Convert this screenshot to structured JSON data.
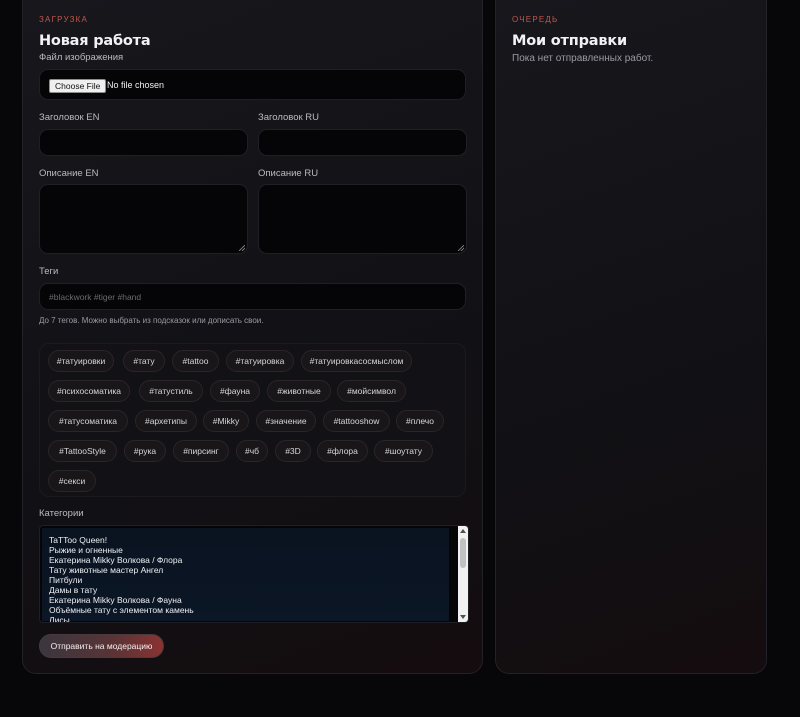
{
  "upload": {
    "eyebrow": "ЗАГРУЗКА",
    "title": "Новая работа",
    "image_label": "Файл изображения",
    "file_button": "Choose File",
    "file_status": "No file chosen",
    "title_en_label": "Заголовок EN",
    "title_ru_label": "Заголовок RU",
    "desc_en_label": "Описание EN",
    "desc_ru_label": "Описание RU",
    "tags_label": "Теги",
    "tags_placeholder": "#blackwork #tiger #hand",
    "tags_hint": "До 7 тегов. Можно выбрать из подсказок или дописать свои.",
    "tag_suggestions": [
      "#татуировки",
      "#тату",
      "#tattoo",
      "#татуировка",
      "#татуировкасосмыслом",
      "#психосоматика",
      "#татустиль",
      "#фауна",
      "#животные",
      "#мойсимвол",
      "#татусоматика",
      "#архетипы",
      "#Mikky",
      "#значение",
      "#tattooshow",
      "#плечо",
      "#TattooStyle",
      "#рука",
      "#пирсинг",
      "#чб",
      "#3D",
      "#флора",
      "#шоутату",
      "#секси"
    ],
    "categories_label": "Категории",
    "categories": [
      "TaTToo Queen!",
      "Рыжие и огненные",
      "Екатерина Mikky Волкова / Флора",
      "Тату животные мастер Ангел",
      "Питбули",
      "Дамы в тату",
      "Екатерина Mikky Волкова / Фауна",
      "Объёмные тату с элементом камень",
      "Лисы"
    ],
    "submit_label": "Отправить на модерацию"
  },
  "queue": {
    "eyebrow": "ОЧЕРЕДЬ",
    "title": "Мои отправки",
    "empty_text": "Пока нет отправленных работ."
  },
  "colors": {
    "accent": "#c0584c",
    "background": "#07070a",
    "panel": "#131317"
  }
}
